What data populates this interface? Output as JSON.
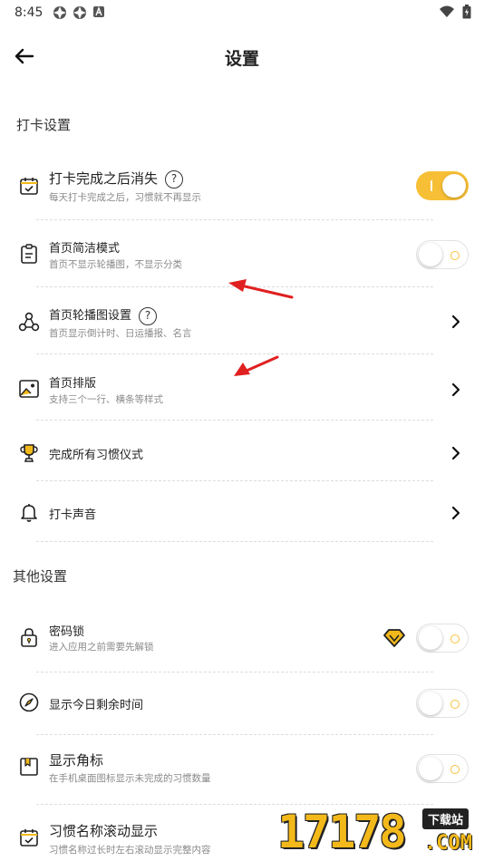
{
  "status_bar": {
    "time": "8:45"
  },
  "header": {
    "title": "设置"
  },
  "sections": {
    "checkin": {
      "title": "打卡设置"
    },
    "other": {
      "title": "其他设置"
    }
  },
  "rows": {
    "disappear": {
      "title": "打卡完成之后消失",
      "subtitle": "每天打卡完成之后，习惯就不再显示",
      "help": "?",
      "toggle": true
    },
    "simple_mode": {
      "title": "首页简洁模式",
      "subtitle": "首页不显示轮播图，不显示分类",
      "toggle": false
    },
    "carousel": {
      "title": "首页轮播图设置",
      "subtitle": "首页显示倒计时、日运播报、名言",
      "help": "?"
    },
    "layout": {
      "title": "首页排版",
      "subtitle": "支持三个一行、横条等样式"
    },
    "ritual": {
      "title": "完成所有习惯仪式"
    },
    "sound": {
      "title": "打卡声音"
    },
    "password_lock": {
      "title": "密码锁",
      "subtitle": "进入应用之前需要先解锁",
      "toggle": false
    },
    "remaining_time": {
      "title": "显示今日剩余时间",
      "toggle": false
    },
    "badge": {
      "title": "显示角标",
      "subtitle": "在手机桌面图标显示未完成的习惯数量",
      "toggle": false
    },
    "scroll_name": {
      "title": "习惯名称滚动显示",
      "subtitle": "习惯名称过长时左右滚动显示完整内容"
    }
  },
  "watermark": {
    "digits": "17178",
    "badge": "下载站",
    "domain": ".COM"
  },
  "colors": {
    "accent": "#f7bf35",
    "annotation_arrow": "#e02020"
  }
}
